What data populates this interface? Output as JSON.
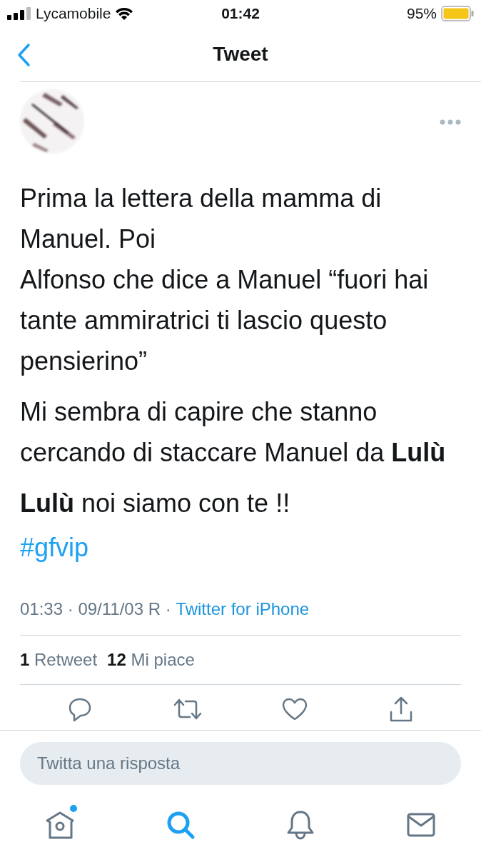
{
  "status_bar": {
    "carrier": "Lycamobile",
    "time": "01:42",
    "battery": "95%"
  },
  "nav": {
    "title": "Tweet"
  },
  "tweet": {
    "avatar": {
      "kind": "picture"
    },
    "paragraphs": [
      "Prima la lettera della mamma di Manuel. Poi\nAlfonso che dice a Manuel “fuori hai tante ammiratrici ti lascio questo pensierino”",
      "Mi sembra di capire che stanno cercando di staccare Manuel da **Lulù**",
      "**Lulù** noi siamo con te !!"
    ],
    "hashtag": "#gfvip",
    "meta": "01:33 · 09/11/03 R · ",
    "source": "Twitter for iPhone",
    "stats": [
      {
        "count": "1",
        "label": "Retweet"
      },
      {
        "count": "12",
        "label": "Mi piace"
      }
    ],
    "actions": [
      {
        "kind": "reply"
      },
      {
        "kind": "retweet"
      },
      {
        "kind": "like"
      },
      {
        "kind": "share"
      }
    ]
  },
  "reply_box": {
    "placeholder": "Twitta una risposta"
  },
  "tab_bar": [
    {
      "kind": "home",
      "selected": false,
      "badge": true
    },
    {
      "kind": "search",
      "selected": true,
      "badge": false
    },
    {
      "kind": "notifications",
      "selected": false,
      "badge": false
    },
    {
      "kind": "messages",
      "selected": false,
      "badge": false
    }
  ]
}
